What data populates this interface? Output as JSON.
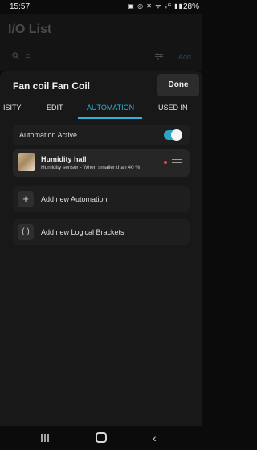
{
  "status_bar": {
    "time": "15:57",
    "indicators": "▣ ◎ ✕ ᯤ ₄ᴳ ▮▮",
    "battery": "28%"
  },
  "background_page": {
    "title": "I/O List",
    "search_value": "F",
    "add_label": "Add"
  },
  "sheet": {
    "title": "Fan coil Fan Coil",
    "done_label": "Done",
    "tabs": [
      {
        "label": "ISITY"
      },
      {
        "label": "EDIT"
      },
      {
        "label": "AUTOMATION"
      },
      {
        "label": "USED IN"
      }
    ],
    "active_tab": "AUTOMATION",
    "automation_active_label": "Automation Active",
    "automation_active": true,
    "automations": [
      {
        "name": "Humidity hall",
        "description": "Humidity sensor - When smaller than 40 %",
        "status_color": "#e05050"
      }
    ],
    "add_automation_label": "Add new Automation",
    "add_brackets_label": "Add new Logical Brackets"
  },
  "colors": {
    "accent": "#2ab4d8",
    "background": "#0b0b0b",
    "sheet": "#181818"
  }
}
